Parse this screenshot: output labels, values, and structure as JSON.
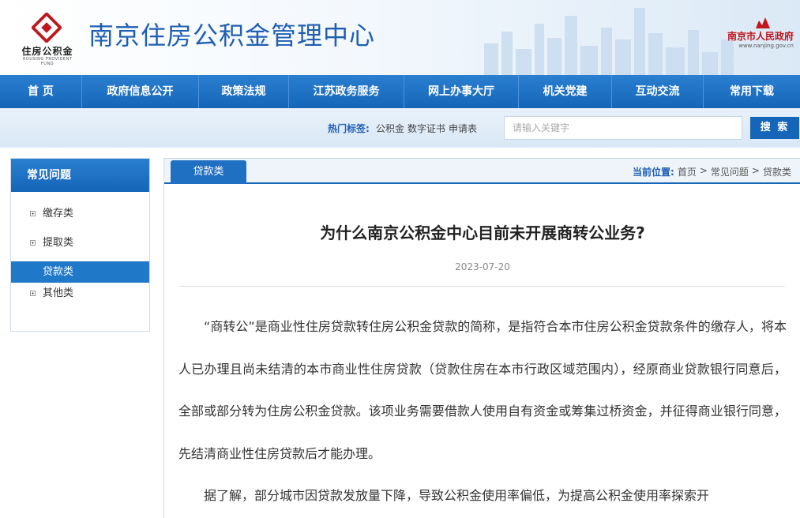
{
  "header": {
    "logo_text": "住房公积金",
    "logo_sub": "HOUSING PROVIDENT FUND",
    "site_title": "南京住房公积金管理中心",
    "gov_name": "南京市人民政府",
    "gov_url": "www.nanjing.gov.cn",
    "brand_color": "#1565b8",
    "accent_red": "#c0161c"
  },
  "nav": {
    "items": [
      {
        "label": "首 页"
      },
      {
        "label": "政府信息公开"
      },
      {
        "label": "政策法规"
      },
      {
        "label": "江苏政务服务"
      },
      {
        "label": "网上办事大厅"
      },
      {
        "label": "机关党建"
      },
      {
        "label": "互动交流"
      },
      {
        "label": "常用下载"
      }
    ]
  },
  "search": {
    "hot_label": "热门标签:",
    "hot_tags": [
      "公积金",
      "数字证书",
      "申请表"
    ],
    "placeholder": "请输入关键字",
    "button_label": "搜 索"
  },
  "sidebar": {
    "title": "常见问题",
    "items": [
      {
        "label": "缴存类",
        "active": false
      },
      {
        "label": "提取类",
        "active": false
      },
      {
        "label": "贷款类",
        "active": true
      },
      {
        "label": "其他类",
        "active": false
      }
    ]
  },
  "content": {
    "tab_label": "贷款类",
    "breadcrumb": {
      "label": "当前位置:",
      "items": [
        "首页",
        "常见问题",
        "贷款类"
      ],
      "separator": ">"
    },
    "title": "为什么南京公积金中心目前未开展商转公业务?",
    "date": "2023-07-20",
    "paragraphs": [
      "“商转公”是商业性住房贷款转住房公积金贷款的简称，是指符合本市住房公积金贷款条件的缴存人，将本人已办理且尚未结清的本市商业性住房贷款（贷款住房在本市行政区域范围内），经原商业贷款银行同意后，全部或部分转为住房公积金贷款。该项业务需要借款人使用自有资金或筹集过桥资金，并征得商业银行同意，先结清商业性住房贷款后才能办理。",
      "据了解，部分城市因贷款发放量下降，导致公积金使用率偏低，为提高公积金使用率探索开"
    ]
  }
}
